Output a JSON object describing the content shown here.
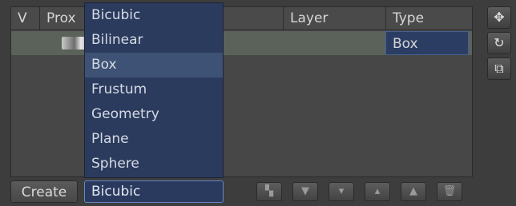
{
  "table": {
    "columns": [
      "V",
      "Prox",
      "Layer",
      "Type"
    ],
    "row": {
      "type": "Box"
    }
  },
  "dropdown": {
    "options": [
      "Bicubic",
      "Bilinear",
      "Box",
      "Frustum",
      "Geometry",
      "Plane",
      "Sphere"
    ],
    "highlighted": "Box"
  },
  "bottom": {
    "create_label": "Create",
    "combo_value": "Bicubic",
    "icons": [
      "copy-icon",
      "move-down-icon",
      "arrow-down-icon",
      "arrow-up-icon",
      "move-top-icon",
      "trash-icon"
    ]
  },
  "side_tools": [
    "move-icon",
    "rotate-icon",
    "scale-icon"
  ]
}
